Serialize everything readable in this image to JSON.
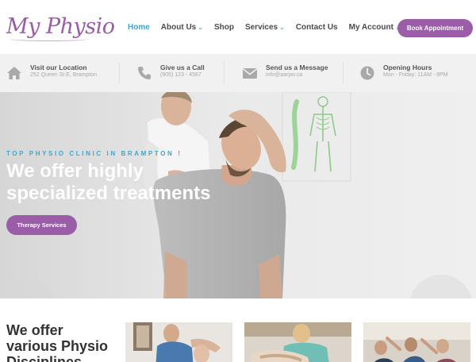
{
  "brand": {
    "logo_text": "My Physio",
    "accent": "#9b5ca8",
    "link": "#3fa7c9"
  },
  "nav": {
    "items": [
      {
        "label": "Home",
        "active": true,
        "dropdown": false
      },
      {
        "label": "About Us",
        "active": false,
        "dropdown": true
      },
      {
        "label": "Shop",
        "active": false,
        "dropdown": false
      },
      {
        "label": "Services",
        "active": false,
        "dropdown": true
      },
      {
        "label": "Contact Us",
        "active": false,
        "dropdown": false
      },
      {
        "label": "My Account",
        "active": false,
        "dropdown": true
      }
    ],
    "cta_label": "Book Appointment"
  },
  "infobar": [
    {
      "icon": "home-icon",
      "title": "Visit our Location",
      "sub": "252 Queen St E, Brampton"
    },
    {
      "icon": "phone-icon",
      "title": "Give us a Call",
      "sub": "(905) 123 - 4567"
    },
    {
      "icon": "envelope-icon",
      "title": "Send us a Message",
      "sub": "info@aarjav.ca"
    },
    {
      "icon": "clock-icon",
      "title": "Opening Hours",
      "sub": "Mon - Friday: 11AM - 8PM"
    }
  ],
  "hero": {
    "eyebrow": "TOP PHYSIO CLINIC IN BRAMPTON !",
    "title": "We offer highly specialized treatments",
    "button_label": "Therapy Services"
  },
  "disciplines": {
    "heading_plain": "We ",
    "heading_bold": "offer",
    "heading_rest": "various Physio Disciplines"
  }
}
